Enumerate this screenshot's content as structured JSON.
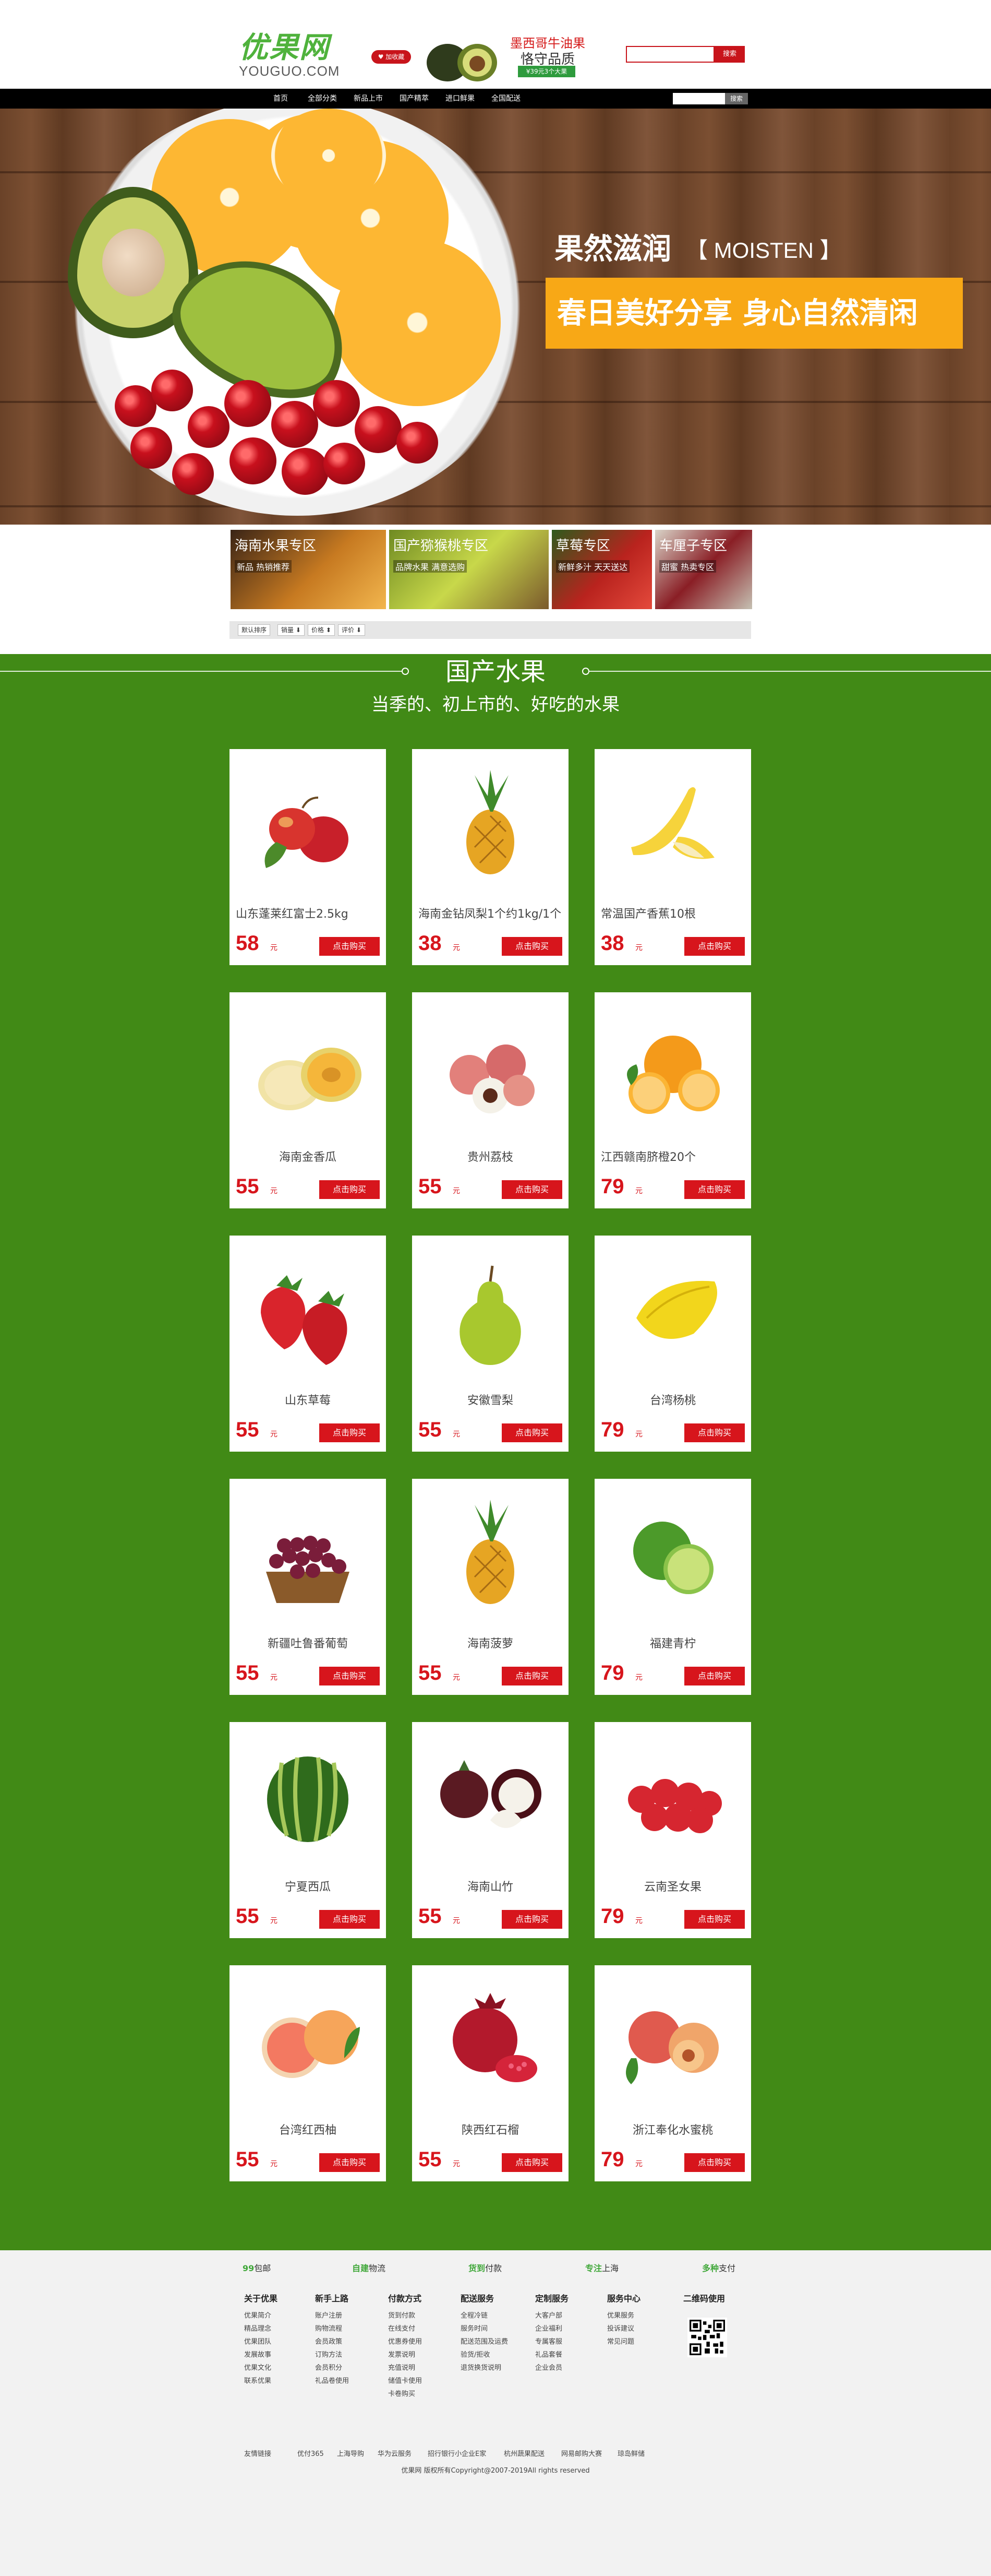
{
  "header": {
    "logo_cn": "优果网",
    "logo_en": "YOUGUO.COM",
    "favorite_label": "♥ 加收藏",
    "promo_title": "墨西哥牛油果",
    "promo_subtitle": "恪守品质",
    "promo_tag": "¥39元3个大果",
    "search_placeholder": "",
    "search_button": "搜索"
  },
  "nav": {
    "items": [
      "首页",
      "全部分类",
      "新品上市",
      "国产精萃",
      "进口鲜果",
      "全国配送"
    ],
    "search_button": "搜索"
  },
  "hero": {
    "title": "果然滋润",
    "title_en": "【 MOISTEN 】",
    "banner": "春日美好分享  身心自然清闲"
  },
  "categories": [
    {
      "label": "海南水果专区",
      "sub": "新品 热销推荐"
    },
    {
      "label": "国产猕猴桃专区",
      "sub": "品牌水果 满意选购"
    },
    {
      "label": "草莓专区",
      "sub": "新鲜多汁 天天送达"
    },
    {
      "label": "车厘子专区",
      "sub": "甜蜜 热卖专区"
    }
  ],
  "sortbar": {
    "items": [
      "默认排序",
      "销量 ⬇",
      "价格 ⬍",
      "评价 ⬇"
    ]
  },
  "section": {
    "title": "国产水果",
    "subtitle": "当季的、初上市的、好吃的水果"
  },
  "products": [
    {
      "name": "山东蓬莱红富士2.5kg",
      "price": "58",
      "unit": "元",
      "buy": "点击购买",
      "icon": "apple-icon"
    },
    {
      "name": "海南金钻凤梨1个约1kg/1个",
      "price": "38",
      "unit": "元",
      "buy": "点击购买",
      "icon": "pineapple-icon"
    },
    {
      "name": "常温国产香蕉10根",
      "price": "38",
      "unit": "元",
      "buy": "点击购买",
      "icon": "banana-icon"
    },
    {
      "name": "海南金香瓜",
      "price": "55",
      "unit": "元",
      "buy": "点击购买",
      "icon": "melon-icon"
    },
    {
      "name": "贵州荔枝",
      "price": "55",
      "unit": "元",
      "buy": "点击购买",
      "icon": "lychee-icon"
    },
    {
      "name": "江西赣南脐橙20个",
      "price": "79",
      "unit": "元",
      "buy": "点击购买",
      "icon": "orange-icon"
    },
    {
      "name": "山东草莓",
      "price": "55",
      "unit": "元",
      "buy": "点击购买",
      "icon": "strawberry-icon"
    },
    {
      "name": "安徽雪梨",
      "price": "55",
      "unit": "元",
      "buy": "点击购买",
      "icon": "pear-icon"
    },
    {
      "name": "台湾杨桃",
      "price": "79",
      "unit": "元",
      "buy": "点击购买",
      "icon": "starfruit-icon"
    },
    {
      "name": "新疆吐鲁番葡萄",
      "price": "55",
      "unit": "元",
      "buy": "点击购买",
      "icon": "grape-icon"
    },
    {
      "name": "海南菠萝",
      "price": "55",
      "unit": "元",
      "buy": "点击购买",
      "icon": "pineapple-icon"
    },
    {
      "name": "福建青柠",
      "price": "79",
      "unit": "元",
      "buy": "点击购买",
      "icon": "lime-icon"
    },
    {
      "name": "宁夏西瓜",
      "price": "55",
      "unit": "元",
      "buy": "点击购买",
      "icon": "watermelon-icon"
    },
    {
      "name": "海南山竹",
      "price": "55",
      "unit": "元",
      "buy": "点击购买",
      "icon": "mangosteen-icon"
    },
    {
      "name": "云南圣女果",
      "price": "79",
      "unit": "元",
      "buy": "点击购买",
      "icon": "tomato-icon"
    },
    {
      "name": "台湾红西柚",
      "price": "55",
      "unit": "元",
      "buy": "点击购买",
      "icon": "grapefruit-icon"
    },
    {
      "name": "陕西红石榴",
      "price": "55",
      "unit": "元",
      "buy": "点击购买",
      "icon": "pomegranate-icon"
    },
    {
      "name": "浙江奉化水蜜桃",
      "price": "79",
      "unit": "元",
      "buy": "点击购买",
      "icon": "peach-icon"
    }
  ],
  "footer": {
    "services": [
      {
        "hl": "99",
        "text": "包邮"
      },
      {
        "hl": "自建",
        "text": "物流"
      },
      {
        "hl": "货到",
        "text": "付款"
      },
      {
        "hl": "专注",
        "text": "上海"
      },
      {
        "hl": "多种",
        "text": "支付"
      }
    ],
    "columns": [
      {
        "title": "关于优果",
        "links": [
          "优果简介",
          "精品理念",
          "优果团队",
          "发展故事",
          "优果文化",
          "联系优果"
        ]
      },
      {
        "title": "新手上路",
        "links": [
          "账户注册",
          "购物流程",
          "会员政策",
          "订购方法",
          "会员积分",
          "礼品卷使用"
        ]
      },
      {
        "title": "付款方式",
        "links": [
          "货到付款",
          "在线支付",
          "优惠券使用",
          "发票说明",
          "充值说明",
          "储值卡使用",
          "卡卷购买"
        ]
      },
      {
        "title": "配送服务",
        "links": [
          "全程冷链",
          "服务时间",
          "配送范围及运费",
          "验货/拒收",
          "退货换货说明"
        ]
      },
      {
        "title": "定制服务",
        "links": [
          "大客户部",
          "企业福利",
          "专属客服",
          "礼品套餐",
          "企业会员"
        ]
      },
      {
        "title": "服务中心",
        "links": [
          "优果服务",
          "投诉建议",
          "常见问题"
        ]
      },
      {
        "title": "二维码使用",
        "links": []
      }
    ],
    "links_label": "友情链接",
    "links": [
      "优付365",
      "上海导购",
      "华为云服务",
      "招行银行小企业E家",
      "杭州蔬果配送",
      "网易邮购大赛",
      "琼岛鲜储"
    ],
    "copyright": "优果网 版权所有Copyright@2007-2019All rights reserved"
  }
}
